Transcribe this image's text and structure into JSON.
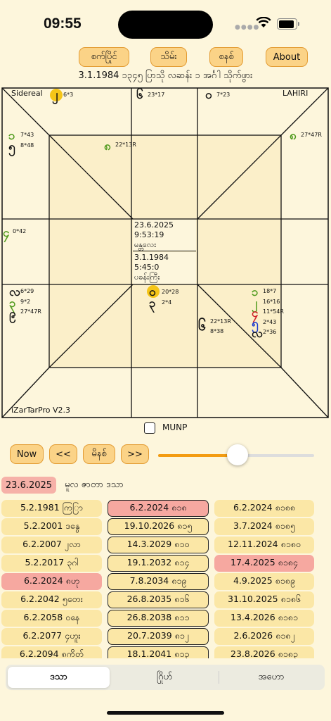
{
  "status": {
    "time": "09:55"
  },
  "toolbar": {
    "btn1": "စက်ပြိုင်",
    "btn2": "သိမ်း",
    "btn3": "စနစ်",
    "btn4": "About"
  },
  "header": {
    "birth_line": "3.1.1984  ၁၃၄၅ ပြာသို လဆန်း ၁ အင်္ဂါ  သိုက်ဖွား"
  },
  "chart": {
    "system": "Sidereal",
    "ayanamsa": "LAHIRI",
    "footer": "iZarTarPro V2.3",
    "planets": {
      "p1": {
        "glyph": "၂",
        "deg": "6*3"
      },
      "p2": {
        "glyph": "၆",
        "deg": "23*17"
      },
      "p3": {
        "glyph": "၀",
        "deg": "7*23"
      },
      "p4": {
        "glyph": "၁",
        "deg": "7*43"
      },
      "p5": {
        "glyph": "၅",
        "deg": "8*48"
      },
      "p6": {
        "glyph": "၈",
        "deg": "22*13R"
      },
      "p7": {
        "glyph": "၈",
        "deg": "27*47R"
      },
      "p8": {
        "glyph": "၄",
        "deg": "0*42"
      },
      "p9": {
        "glyph": "လ",
        "deg": "6*29"
      },
      "p10": {
        "glyph": "၃",
        "deg": "9*2"
      },
      "p11": {
        "glyph": "၉",
        "deg": "27*47R"
      },
      "p12": {
        "glyph": "၀",
        "deg": "20*28"
      },
      "p13": {
        "glyph": "၃",
        "deg": "2*4"
      },
      "p14": {
        "glyph": "၆",
        "deg": "22*13R"
      },
      "p15": {
        "glyph": "",
        "deg": "8*38"
      },
      "p16": {
        "glyph": "၁",
        "deg": "18*7"
      },
      "p17": {
        "glyph": "၂",
        "deg": "16*16"
      },
      "p18": {
        "glyph": "၄",
        "deg": "11*54R"
      },
      "p19": {
        "glyph": "၅",
        "deg": "2*43"
      },
      "p20": {
        "glyph": "လ",
        "deg": "2*36"
      }
    },
    "center_top": {
      "date": "23.6.2025",
      "time": "9:53:19",
      "name": "မန္တလေး"
    },
    "center_bottom": {
      "date": "3.1.1984",
      "time": "5:45:0",
      "name": "ပခန်းကြီး"
    }
  },
  "munp_label": "MUNP",
  "nav": {
    "now": "Now",
    "prev": "<<",
    "ok": "မိနစ်",
    "next": ">>",
    "slider_value": 0.5
  },
  "dasa": {
    "date": "23.6.2025",
    "label": "မူလ ဇာတာ ဒသာ"
  },
  "grid": {
    "col1": [
      "5.2.1981 ကြြာ",
      "5.2.2001 ဒနွေ",
      "6.2.2007 ၂လာ",
      "5.2.2017 ၃ဂါ",
      "6.2.2024 ၈ဟု",
      "6.2.2042 ၅တေး",
      "6.2.2058 ၀နေ",
      "6.2.2077 ၄ဟူး",
      "6.2.2094 ၈ကိတ်"
    ],
    "col2": [
      "6.2.2024 ၈၁၈",
      "19.10.2026 ၈၁၅",
      "14.3.2029 ၈၁၀",
      "19.1.2032 ၈၁၄",
      "7.8.2034 ၈၁၉",
      "26.8.2035 ၈၁၆",
      "26.8.2038 ၈၁၁",
      "20.7.2039 ၈၁၂",
      "18.1.2041 ၈၁၃"
    ],
    "col3": [
      "6.2.2024 ၈၁၈၈",
      "3.7.2024 ၈၁၈၅",
      "12.11.2024 ၈၁၈၀",
      "17.4.2025 ၈၁၈၄",
      "4.9.2025 ၈၁၈၉",
      "31.10.2025 ၈၁၈၆",
      "13.4.2026 ၈၁၈၁",
      "2.6.2026 ၈၁၈၂",
      "23.8.2026 ၈၁၈၃"
    ]
  },
  "tabs": {
    "t1": "ဒသာ",
    "t2": "ဂြိုဟ်",
    "t3": "အဟော"
  }
}
